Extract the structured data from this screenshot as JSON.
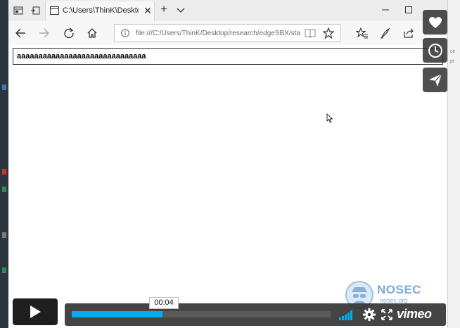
{
  "browser": {
    "tab_title": "C:\\Users\\ThinK\\Desktop",
    "address": "file:///C:/Users/ThinK/Desktop/research/edgeSBX/sta",
    "icons": [
      "tab-preview-icon",
      "set-aside-icon",
      "page-icon",
      "close-icon",
      "new-tab-icon",
      "chevron-down-icon",
      "minimize-icon",
      "maximize-icon",
      "back-icon",
      "forward-icon",
      "refresh-icon",
      "home-icon",
      "info-icon",
      "reading-view-icon",
      "favorite-star-icon",
      "favorites-hub-icon",
      "pen-icon",
      "share-icon"
    ]
  },
  "page": {
    "input_value": "aaaaaaaaaaaaaaaaaaaaaaaaaaaaaa"
  },
  "player": {
    "time": "00:04",
    "progress": 0.35,
    "brand": "vimeo",
    "accent": "#00adef"
  },
  "watermark": {
    "title": "NOSEC",
    "subtitle": "nosec.org"
  },
  "side_buttons": [
    "heart-icon",
    "clock-icon",
    "send-icon"
  ]
}
